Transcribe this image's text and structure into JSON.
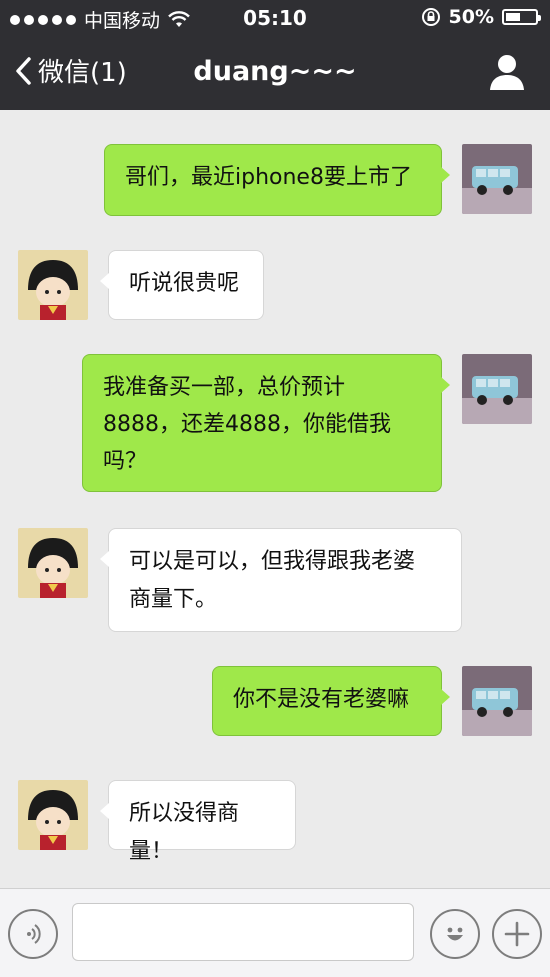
{
  "status_bar": {
    "carrier": "中国移动",
    "time": "05:10",
    "battery_percent": "50%",
    "battery_level": 0.5
  },
  "nav": {
    "back_label": "微信(1)",
    "title": "duang~~~"
  },
  "messages": [
    {
      "sender": "me",
      "text": "哥们，最近iphone8要上市了"
    },
    {
      "sender": "other",
      "text": "听说很贵呢"
    },
    {
      "sender": "me",
      "lines": [
        "我准备买一部，总价预计",
        "8888，还差4888，你能借我",
        "吗？"
      ]
    },
    {
      "sender": "other",
      "lines": [
        "可以是可以，但我得跟我老婆",
        "商量下。"
      ]
    },
    {
      "sender": "me",
      "text": "你不是没有老婆嘛"
    },
    {
      "sender": "other",
      "text": "所以没得商量！"
    }
  ],
  "input_bar": {
    "placeholder": ""
  },
  "colors": {
    "header_bg": "#2f2f33",
    "chat_bg": "#ebebeb",
    "my_bubble": "#9fe84a",
    "other_bubble": "#ffffff"
  },
  "icons": [
    "signal-dots-icon",
    "wifi-icon",
    "rotation-lock-icon",
    "battery-icon",
    "back-chevron-icon",
    "profile-icon",
    "voice-icon",
    "emoji-icon",
    "plus-icon"
  ]
}
